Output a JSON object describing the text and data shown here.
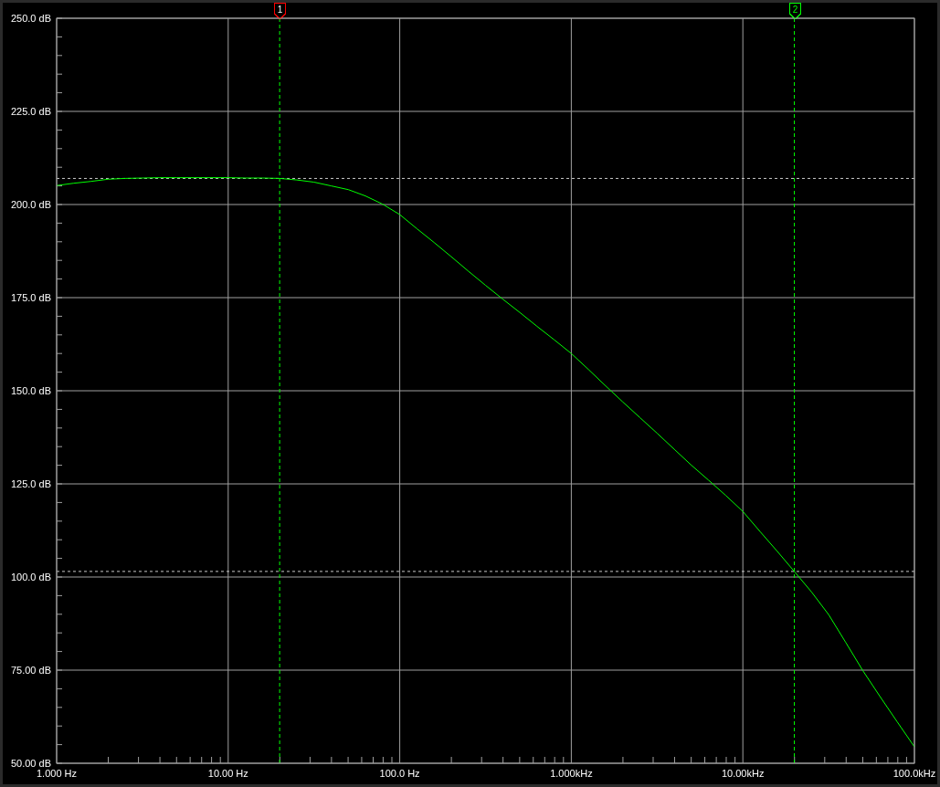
{
  "chart_data": {
    "type": "line",
    "categories": [
      "1.000 Hz",
      null,
      null,
      null,
      null,
      null,
      null,
      null,
      null,
      null,
      "10.00 Hz",
      null,
      null,
      null,
      null,
      null,
      null,
      null,
      null,
      null,
      "100.0 Hz",
      null,
      null,
      null,
      null,
      null,
      null,
      null,
      null,
      null,
      "1.000kHz",
      null,
      null,
      null,
      null,
      null,
      null,
      null,
      null,
      null,
      "10.00kHz",
      null,
      null,
      null,
      null,
      null,
      null,
      null,
      null,
      null,
      "100.0kHz"
    ],
    "grid": true,
    "series": [
      {
        "color": "#00ff00",
        "values": [
          205.1,
          205.7,
          206.2,
          206.8,
          207.0,
          207.1,
          207.2,
          207.2,
          207.2,
          207.2,
          207.2,
          207.1,
          207.1,
          207.0,
          206.6,
          206.0,
          205.0,
          204.0,
          202.3,
          200.1,
          197.3,
          193.5,
          189.8,
          186.0,
          182.1,
          178.3,
          174.6,
          171.0,
          167.3,
          163.7,
          160.0,
          155.7,
          151.3,
          147.0,
          142.8,
          138.6,
          134.3,
          130.0,
          126.0,
          121.9,
          117.6,
          112.2,
          106.9,
          101.5,
          96.0,
          89.9,
          82.4,
          74.8,
          67.9,
          61.1,
          54.4
        ]
      }
    ],
    "ylim": [
      50,
      250
    ],
    "yticks": [
      {
        "value": 250,
        "label": "250.0 dB"
      },
      {
        "value": 225,
        "label": "225.0 dB"
      },
      {
        "value": 200,
        "label": "200.0 dB"
      },
      {
        "value": 175,
        "label": "175.0 dB"
      },
      {
        "value": 150,
        "label": "150.0 dB"
      },
      {
        "value": 125,
        "label": "125.0 dB"
      },
      {
        "value": 100,
        "label": "100.0 dB"
      },
      {
        "value": 75,
        "label": "75.00 dB"
      },
      {
        "value": 50,
        "label": "50.00 dB"
      }
    ],
    "annotations": [
      "1",
      "2"
    ],
    "ref_lines": [
      {
        "axis": "y",
        "value": 207.0
      },
      {
        "axis": "y",
        "value": 101.5
      }
    ]
  },
  "cursors": [
    {
      "color": "#ff0000"
    },
    {
      "color": "#00ff00"
    }
  ]
}
